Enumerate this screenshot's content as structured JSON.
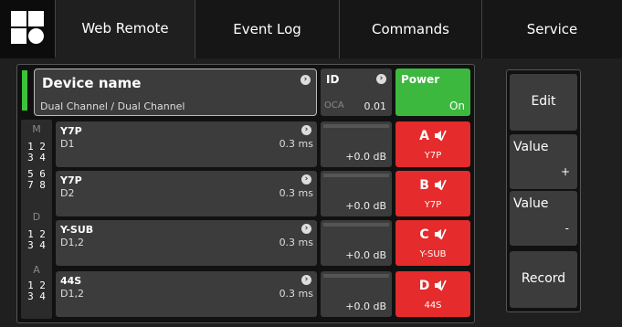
{
  "nav": {
    "logo_icon": "app-logo-icon",
    "tabs": [
      {
        "label": "Web Remote",
        "active": true
      },
      {
        "label": "Event Log",
        "active": false
      },
      {
        "label": "Commands",
        "active": false
      },
      {
        "label": "Service",
        "active": false
      }
    ]
  },
  "device": {
    "name": "Device name",
    "subtitle": "Dual Channel / Dual Channel",
    "id_label": "ID",
    "id_prefix": "OCA",
    "id_value": "0.01",
    "power_label": "Power",
    "power_state": "On",
    "status_color": "#3dc33a"
  },
  "side": {
    "groups": [
      "M",
      "D",
      "A"
    ],
    "pairs": [
      {
        "top": "1 2",
        "bottom": "3 4"
      },
      {
        "top": "5 6",
        "bottom": "7 8"
      },
      {
        "top": "1 2",
        "bottom": "3 4"
      },
      {
        "top": "1 2",
        "bottom": "3 4"
      }
    ]
  },
  "channels": [
    {
      "name": "Y7P",
      "input": "D1",
      "delay": "0.3 ms",
      "gain": "+0.0 dB",
      "letter": "A",
      "mute_label": "Y7P"
    },
    {
      "name": "Y7P",
      "input": "D2",
      "delay": "0.3 ms",
      "gain": "+0.0 dB",
      "letter": "B",
      "mute_label": "Y7P"
    },
    {
      "name": "Y-SUB",
      "input": "D1,2",
      "delay": "0.3 ms",
      "gain": "+0.0 dB",
      "letter": "C",
      "mute_label": "Y-SUB"
    },
    {
      "name": "44S",
      "input": "D1,2",
      "delay": "0.3 ms",
      "gain": "+0.0 dB",
      "letter": "D",
      "mute_label": "44S"
    }
  ],
  "buttons": {
    "edit": "Edit",
    "value_plus": "Value",
    "plus": "+",
    "value_minus": "Value",
    "minus": "-",
    "record": "Record"
  },
  "colors": {
    "mute_red": "#e52b2b",
    "power_green": "#3cb83f"
  }
}
